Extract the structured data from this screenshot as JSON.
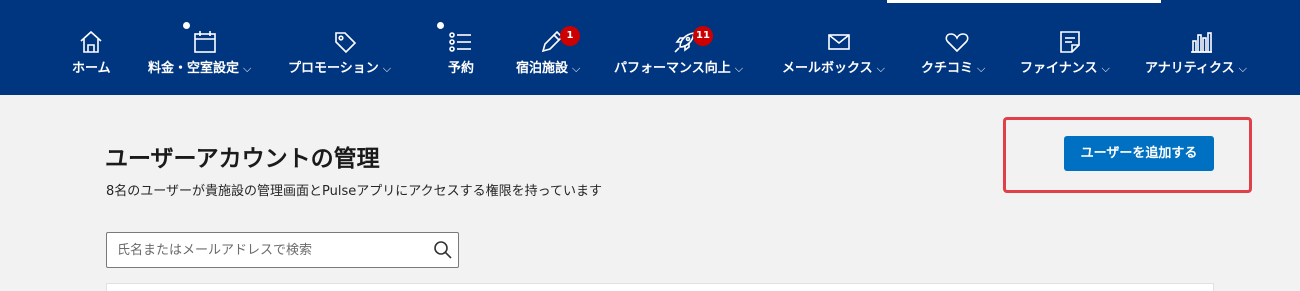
{
  "nav": {
    "items": [
      {
        "label": "ホーム",
        "icon": "home-icon",
        "chevron": false,
        "dot": false
      },
      {
        "label": "料金・空室設定",
        "icon": "calendar-icon",
        "chevron": true,
        "dot": true
      },
      {
        "label": "プロモーション",
        "icon": "tag-icon",
        "chevron": true,
        "dot": false
      },
      {
        "label": "予約",
        "icon": "list-icon",
        "chevron": false,
        "dot": true
      },
      {
        "label": "宿泊施設",
        "icon": "pencil-icon",
        "chevron": true,
        "badge": "1"
      },
      {
        "label": "パフォーマンス向上",
        "icon": "rocket-icon",
        "chevron": true,
        "badge": "11"
      },
      {
        "label": "メールボックス",
        "icon": "mail-icon",
        "chevron": true
      },
      {
        "label": "クチコミ",
        "icon": "heart-icon",
        "chevron": true
      },
      {
        "label": "ファイナンス",
        "icon": "note-icon",
        "chevron": true
      },
      {
        "label": "アナリティクス",
        "icon": "bar-chart-icon",
        "chevron": true
      }
    ],
    "chevron_glyph": "⌵"
  },
  "page": {
    "title": "ユーザーアカウントの管理",
    "subtitle": "8名のユーザーが貴施設の管理画面とPulseアプリにアクセスする権限を持っています",
    "add_user_button": "ユーザーを追加する"
  },
  "search": {
    "placeholder": "氏名またはメールアドレスで検索",
    "value": ""
  },
  "colors": {
    "topbar": "#003580",
    "button": "#0071c2",
    "badge": "#cc0000",
    "highlight": "#e0404a"
  }
}
